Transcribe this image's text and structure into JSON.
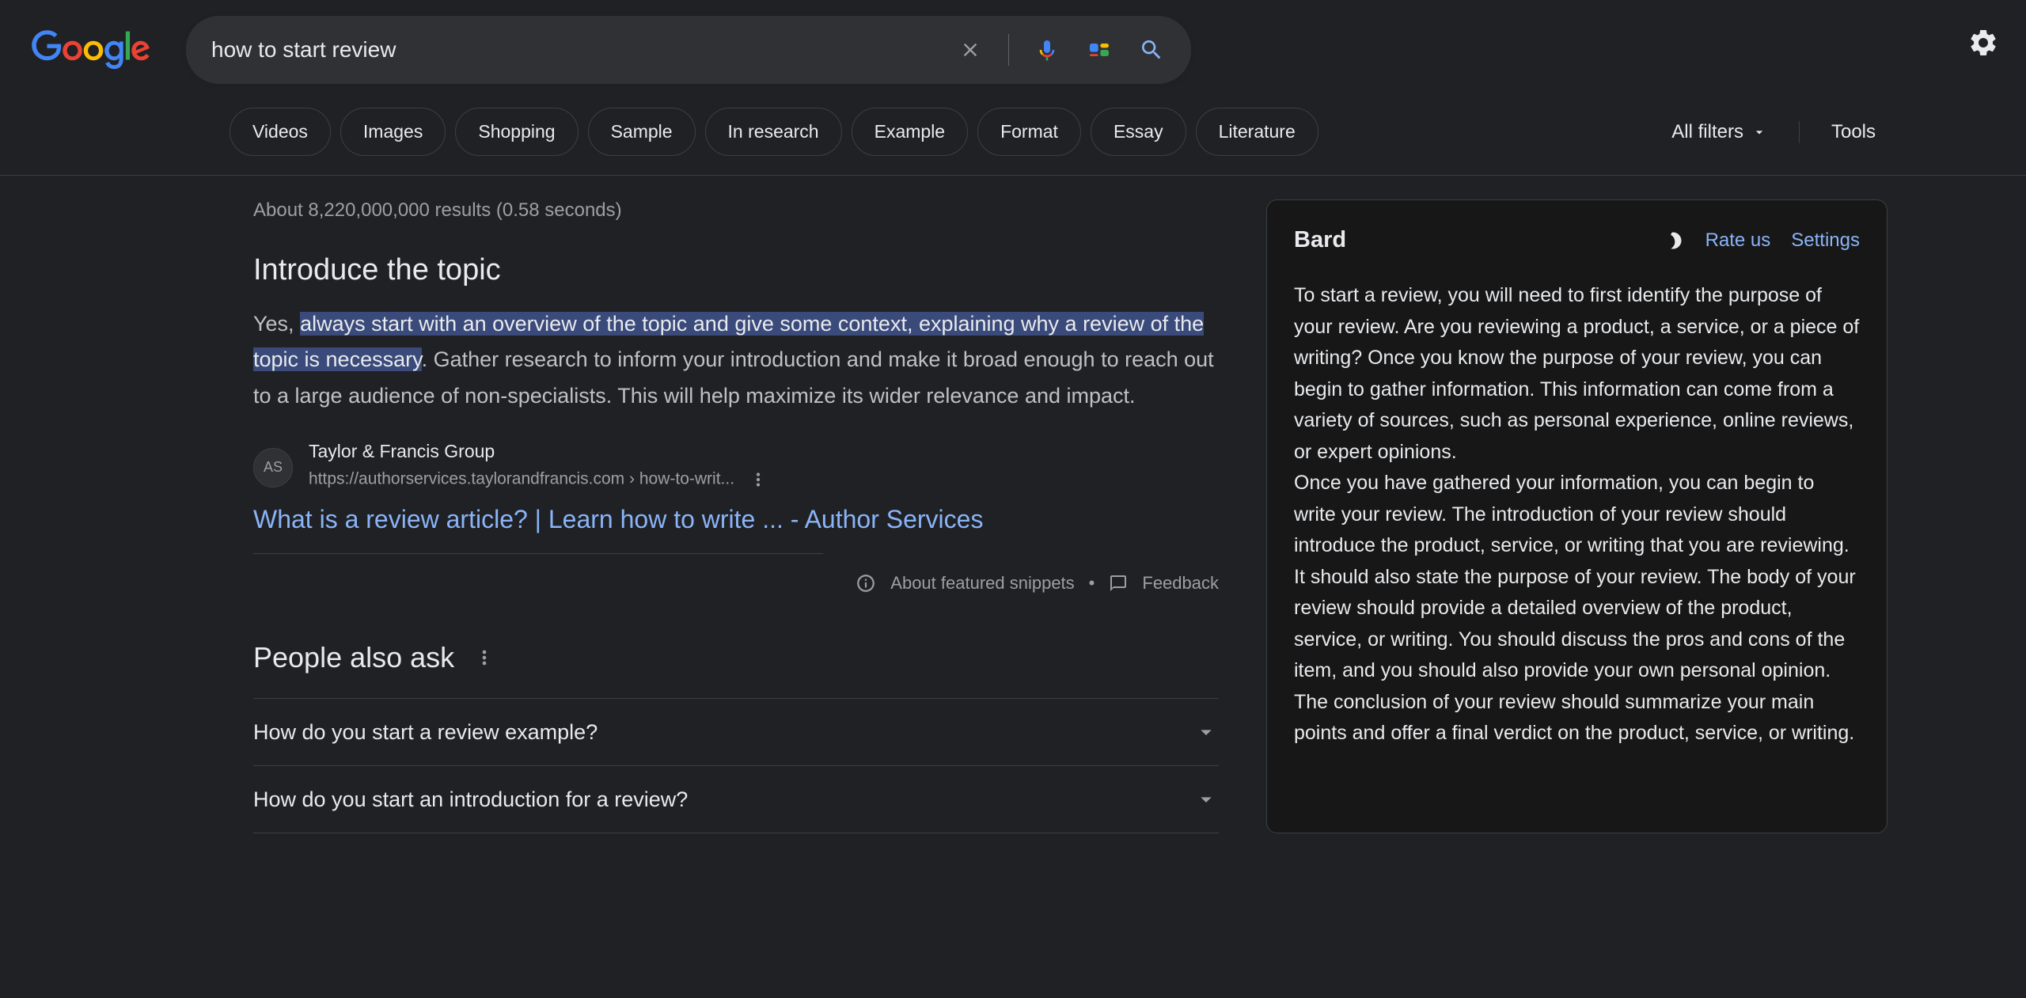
{
  "search": {
    "query": "how to start review",
    "clear_label": "Clear",
    "voice_label": "Search by voice",
    "lens_label": "Search by image",
    "submit_label": "Search"
  },
  "chips": [
    "Videos",
    "Images",
    "Shopping",
    "Sample",
    "In research",
    "Example",
    "Format",
    "Essay",
    "Literature"
  ],
  "filters": {
    "all_filters": "All filters",
    "tools": "Tools"
  },
  "stats": "About 8,220,000,000 results (0.58 seconds)",
  "snippet": {
    "heading": "Introduce the topic",
    "prefix": "Yes, ",
    "highlight": "always start with an overview of the topic and give some context, explaining why a review of the topic is necessary",
    "suffix": ". Gather research to inform your introduction and make it broad enough to reach out to a large audience of non-specialists. This will help maximize its wider relevance and impact."
  },
  "source": {
    "favicon_label": "AS",
    "name": "Taylor & Francis Group",
    "host": "https://authorservices.taylorandfrancis.com",
    "path": " › how-to-writ...",
    "title": "What is a review article? | Learn how to write ... - Author Services"
  },
  "featured_row": {
    "about": "About featured snippets",
    "dot": "•",
    "feedback": "Feedback"
  },
  "paa": {
    "title": "People also ask",
    "items": [
      "How do you start a review example?",
      "How do you start an introduction for a review?"
    ]
  },
  "bard": {
    "title": "Bard",
    "rate_us": "Rate us",
    "settings": "Settings",
    "para1": "To start a review, you will need to first identify the purpose of your review. Are you reviewing a product, a service, or a piece of writing? Once you know the purpose of your review, you can begin to gather information. This information can come from a variety of sources, such as personal experience, online reviews, or expert opinions.",
    "para2": "Once you have gathered your information, you can begin to write your review. The introduction of your review should introduce the product, service, or writing that you are reviewing. It should also state the purpose of your review. The body of your review should provide a detailed overview of the product, service, or writing. You should discuss the pros and cons of the item, and you should also provide your own personal opinion. The conclusion of your review should summarize your main points and offer a final verdict on the product, service, or writing."
  }
}
